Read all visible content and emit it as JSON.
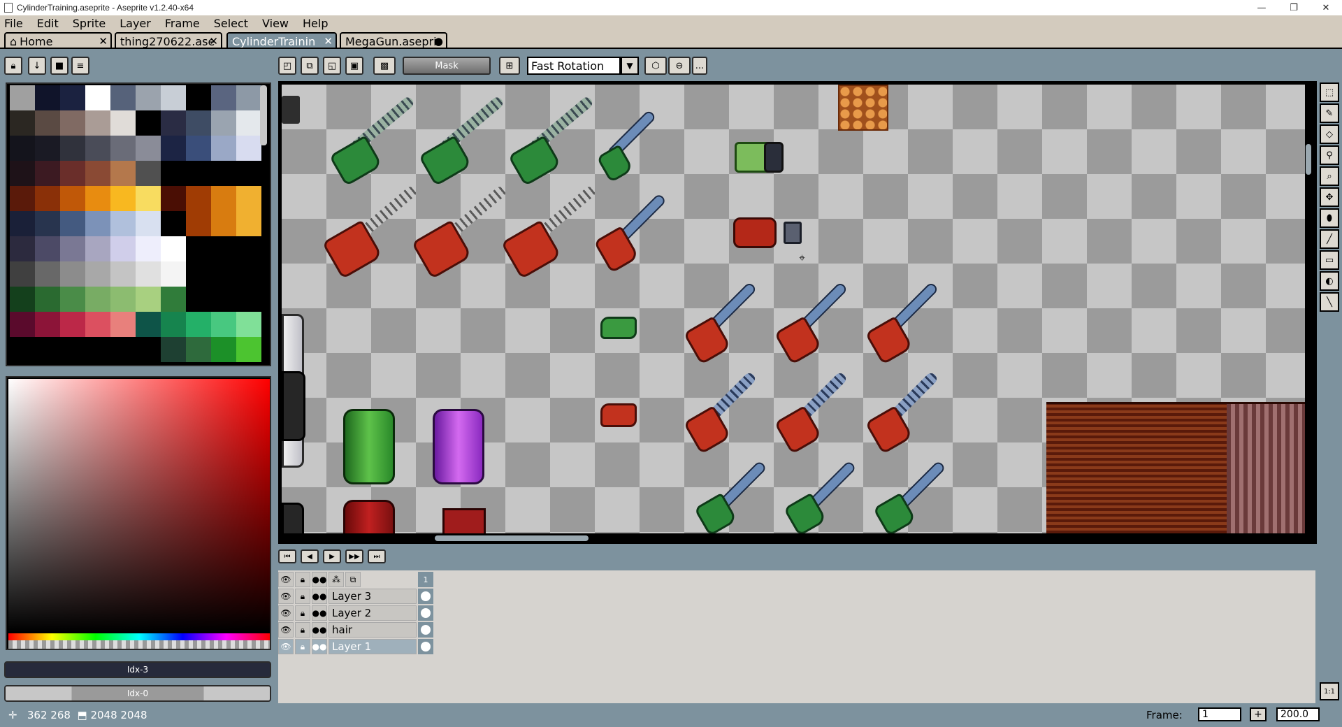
{
  "window": {
    "title": "CylinderTraining.aseprite - Aseprite v1.2.40-x64",
    "min_glyph": "—",
    "max_glyph": "❐",
    "close_glyph": "✕"
  },
  "menu": [
    "File",
    "Edit",
    "Sprite",
    "Layer",
    "Frame",
    "Select",
    "View",
    "Help"
  ],
  "tabs": [
    {
      "label": "Home",
      "close": "✕"
    },
    {
      "label": "thing270622.ase",
      "close": "✕"
    },
    {
      "label": "CylinderTrainin",
      "close": "✕"
    },
    {
      "label": "MegaGun.asepri",
      "close": "●"
    }
  ],
  "toolbar": {
    "mask_label": "Mask",
    "rotation_algorithm": "Fast Rotation",
    "more": "..."
  },
  "colors": {
    "face": "#7d929e",
    "palette": [
      "#a0a0a0",
      "#10142a",
      "#1b2240",
      "#ffffff",
      "#56627a",
      "#9ba3ad",
      "#c8ced6",
      "#000000",
      "#5a6580",
      "#8d99a6",
      "#2b2722",
      "#5a4a43",
      "#806a63",
      "#aa9c96",
      "#e0dcd8",
      "#000000",
      "#2a2c44",
      "#3e4c64",
      "#9aa4b0",
      "#e4e8ec",
      "#14141c",
      "#1a1a24",
      "#30323c",
      "#4a4c58",
      "#6a6c78",
      "#8a8c98",
      "#1c2444",
      "#3a4e7a",
      "#9aa8c6",
      "#d8dcf0",
      "#1e1218",
      "#3c1a22",
      "#6a2e2a",
      "#8a4a34",
      "#b4784c",
      "#505050",
      "#000000",
      "#000000",
      "#000000",
      "#000000",
      "#5a1a0a",
      "#8a3008",
      "#c05808",
      "#e88c10",
      "#f8b820",
      "#f8dc60",
      "#4a0e04",
      "#a03c04",
      "#d87c10",
      "#f0b030",
      "#1a2038",
      "#28344e",
      "#445a80",
      "#7c92b8",
      "#b0c0dc",
      "#d8e0f0",
      "#000000",
      "#a03c04",
      "#d87c10",
      "#f0b030",
      "#2c2a3e",
      "#4c4a66",
      "#7a7894",
      "#a8a6c0",
      "#d0ceea",
      "#eeeefc",
      "#ffffff",
      "#000000",
      "#000000",
      "#000000",
      "#404040",
      "#686868",
      "#8c8c8c",
      "#a8a8a8",
      "#c4c4c4",
      "#e0e0e0",
      "#f4f4f4",
      "#000000",
      "#000000",
      "#000000",
      "#14401c",
      "#2a6a30",
      "#4a8c48",
      "#78ac64",
      "#8cbc70",
      "#a8d080",
      "#307c3a",
      "#000000",
      "#000000",
      "#000000",
      "#5a0a2c",
      "#8c1438",
      "#bc2848",
      "#dc5060",
      "#e8807c",
      "#0e5448",
      "#16844e",
      "#24b068",
      "#48c880",
      "#80e098",
      "#000000",
      "#000000",
      "#000000",
      "#000000",
      "#000000",
      "#000000",
      "#1e4032",
      "#2e6a3c",
      "#1c9028",
      "#4cc430"
    ]
  },
  "color_bars": {
    "fg": "Idx-3",
    "bg": "Idx-0"
  },
  "timeline": {
    "frame_header": "1",
    "layers": [
      "Layer 3",
      "Layer 2",
      "hair",
      "Layer 1"
    ]
  },
  "status": {
    "coords": "362 268",
    "size": "2048 2048",
    "frame_label": "Frame:",
    "frame_value": "1",
    "zoom_value": "200.0"
  }
}
